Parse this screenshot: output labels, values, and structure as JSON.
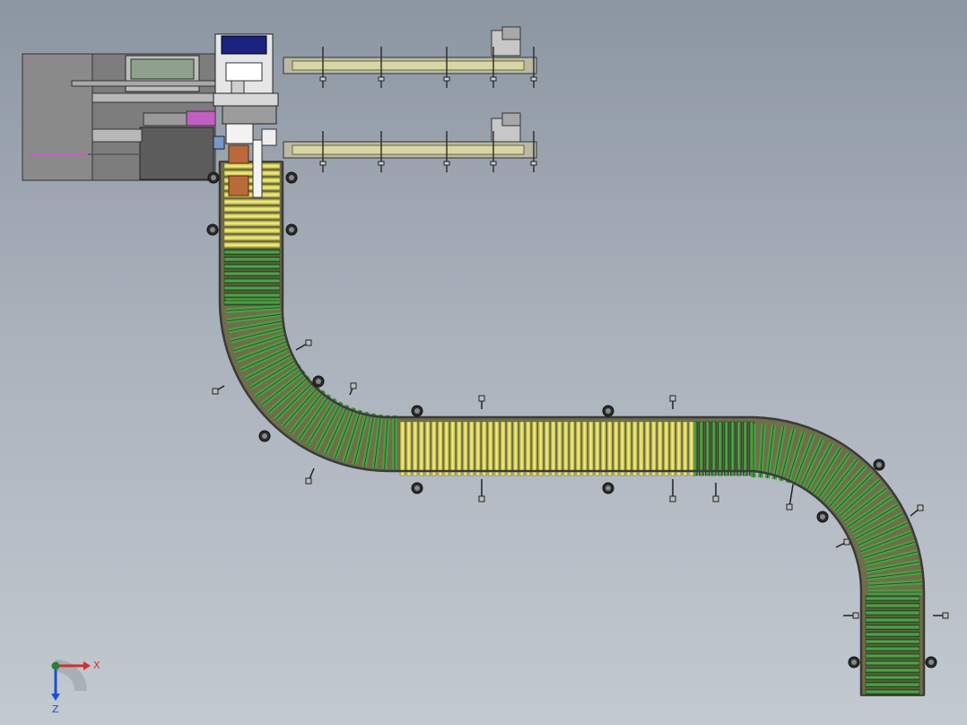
{
  "triad": {
    "x_label": "X",
    "z_label": "Z"
  },
  "colors": {
    "background_top": "#8c96a2",
    "background_bottom": "#c3c9d0",
    "roller_green": "#3f8f3a",
    "roller_green_dark": "#1f4a1c",
    "roller_yellow": "#e9e26a",
    "frame_olive": "#8e8a3a",
    "machine_grey": "#7b7b7b",
    "motor_magenta": "#c060c0",
    "hood_blue": "#1a237e",
    "axis_x": "#d32f2f",
    "axis_y": "#2e7d32",
    "axis_z": "#1e4fd1"
  }
}
